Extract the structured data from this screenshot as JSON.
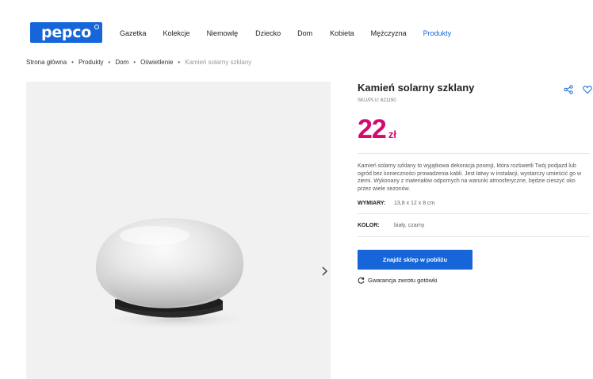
{
  "header": {
    "logo_text": "pepco",
    "nav": [
      "Gazetka",
      "Kolekcje",
      "Niemowlę",
      "Dziecko",
      "Dom",
      "Kobieta",
      "Mężczyzna",
      "Produkty"
    ],
    "active_nav": "Produkty"
  },
  "breadcrumb": [
    "Strona główna",
    "Produkty",
    "Dom",
    "Oświetlenie",
    "Kamień solarny szklany"
  ],
  "product": {
    "title": "Kamień solarny szklany",
    "sku": "SKU/PLU: 621150",
    "price": "22",
    "currency": "zł",
    "description": "Kamień solarny szklany to wyjątkowa dekoracja posesji, która rozświetli Twój podjazd lub ogród bez konieczności prowadzenia kabli. Jest łatwy w instalacji, wystarczy umieścić go w ziemi. Wykonany z materiałów odpornych na warunki atmosferyczne, będzie cieszyć oko przez wiele sezonów.",
    "attributes": [
      {
        "label": "WYMIARY:",
        "value": "13,8 x 12 x 8 cm"
      },
      {
        "label": "KOLOR:",
        "value": "biały, czarny"
      }
    ],
    "cta_label": "Znajdź sklep w pobliżu",
    "guarantee_label": "Gwarancja zwrotu gotówki"
  },
  "colors": {
    "brand_blue": "#1666d9",
    "price_magenta": "#d30a6f"
  },
  "icons": [
    "share-icon",
    "heart-icon",
    "chevron-right-icon",
    "refresh-icon"
  ]
}
